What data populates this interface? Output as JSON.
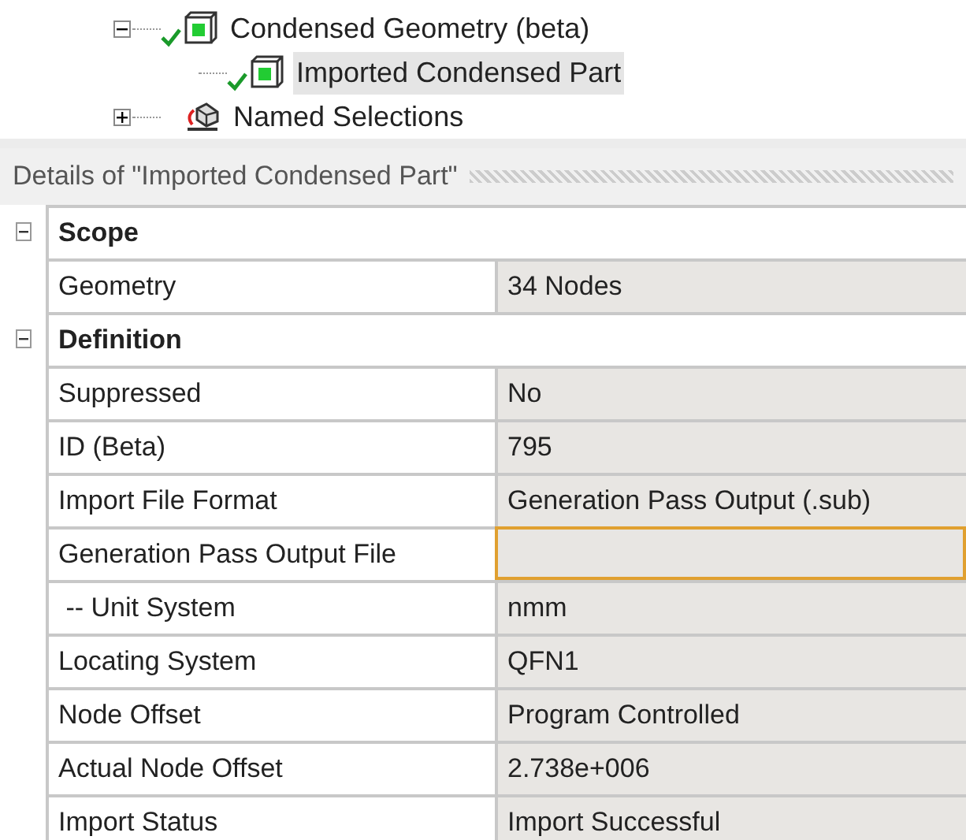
{
  "tree": [
    {
      "label": "Condensed Geometry (beta)",
      "kind": "part",
      "checked": true,
      "expanded": true,
      "selected": false,
      "children": [
        {
          "label": "Imported Condensed Part",
          "kind": "part",
          "checked": true,
          "selected": true
        }
      ]
    },
    {
      "label": "Named Selections",
      "kind": "selection",
      "checked": false,
      "expanded": false,
      "selected": false
    }
  ],
  "details": {
    "title": "Details of \"Imported Condensed Part\"",
    "groups": [
      {
        "label": "Scope",
        "expanded": true,
        "rows": [
          {
            "label": "Geometry",
            "value": "34 Nodes",
            "focused": false
          }
        ]
      },
      {
        "label": "Definition",
        "expanded": true,
        "rows": [
          {
            "label": "Suppressed",
            "value": "No",
            "focused": false
          },
          {
            "label": "ID (Beta)",
            "value": "795",
            "focused": false
          },
          {
            "label": "Import File Format",
            "value": "Generation Pass Output (.sub)",
            "focused": false
          },
          {
            "label": "Generation Pass Output File",
            "focused": true
          },
          {
            "label": " -- Unit System",
            "value": "nmm",
            "focused": false
          },
          {
            "label": "Locating System",
            "value": "QFN1",
            "focused": false
          },
          {
            "label": "Node Offset",
            "value": "Program Controlled",
            "focused": false
          },
          {
            "label": "Actual Node Offset",
            "value": "2.738e+006",
            "focused": false
          },
          {
            "label": "Import Status",
            "value": "Import Successful",
            "focused": false
          }
        ]
      }
    ]
  }
}
